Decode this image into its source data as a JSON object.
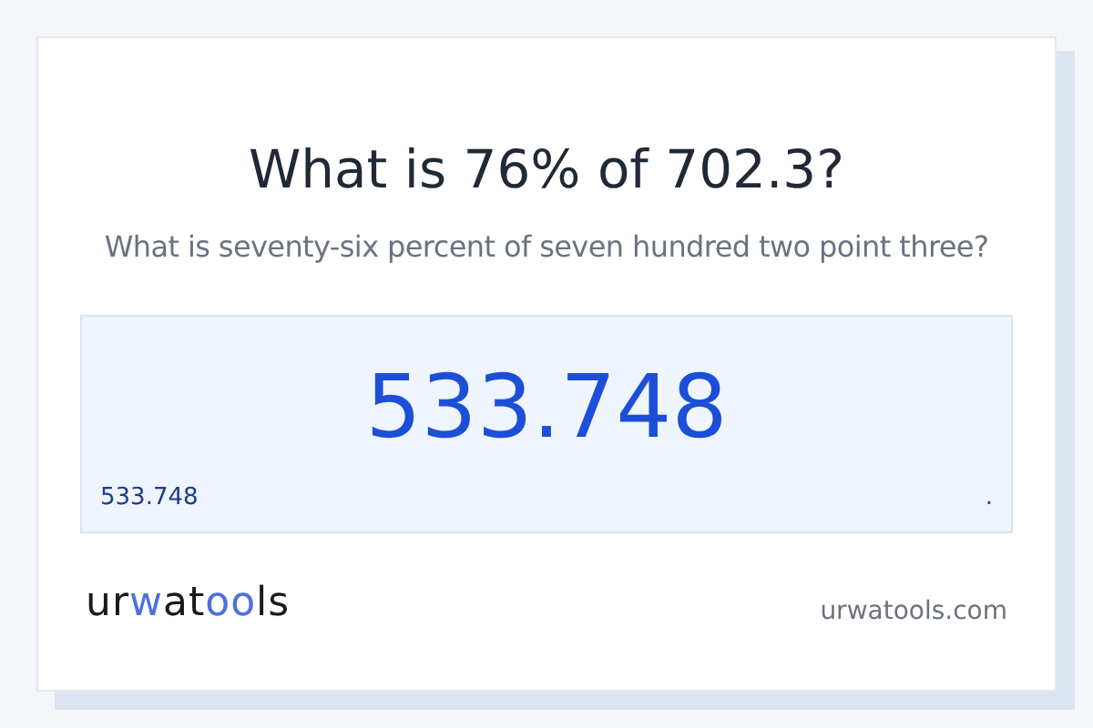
{
  "title": "What is 76% of 702.3?",
  "subtitle": "What is seventy-six percent of seven hundred two point three?",
  "result": {
    "value": "533.748",
    "small_value": "533.748",
    "small_mark": "."
  },
  "logo": [
    {
      "text": "ur",
      "accent": false
    },
    {
      "text": "w",
      "accent": true
    },
    {
      "text": "at",
      "accent": false
    },
    {
      "text": "oo",
      "accent": true
    },
    {
      "text": "ls",
      "accent": false
    }
  ],
  "site": "urwatools.com"
}
